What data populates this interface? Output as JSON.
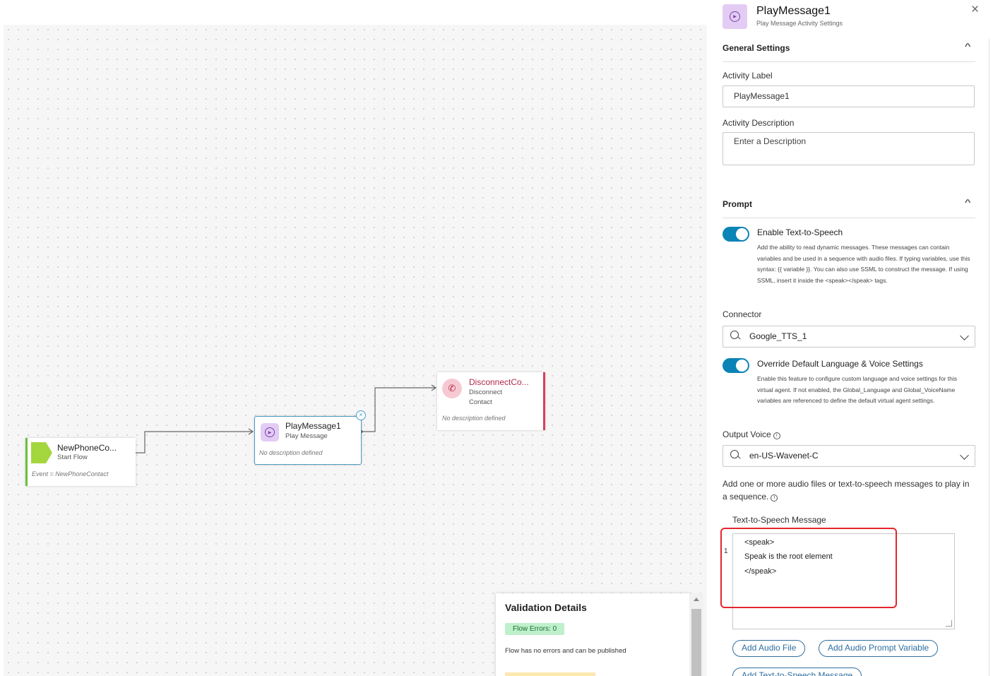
{
  "canvas": {
    "nodes": {
      "start": {
        "title": "NewPhoneCo...",
        "subtitle": "Start Flow",
        "event": "Event = NewPhoneContact"
      },
      "play": {
        "title": "PlayMessage1",
        "subtitle": "Play Message",
        "description": "No description defined",
        "close": "×"
      },
      "disconnect": {
        "title": "DisconnectCo...",
        "subtitle_line1": "Disconnect",
        "subtitle_line2": "Contact",
        "description": "No description defined"
      }
    },
    "validation": {
      "title": "Validation Details",
      "badge": "Flow Errors: 0",
      "message": "Flow has no errors and can be published"
    }
  },
  "panel": {
    "title": "PlayMessage1",
    "subtitle": "Play Message Activity Settings",
    "close": "×",
    "general": {
      "heading": "General Settings",
      "activity_label_label": "Activity Label",
      "activity_label_value": "PlayMessage1",
      "activity_description_label": "Activity Description",
      "activity_description_placeholder": "Enter a Description"
    },
    "prompt": {
      "heading": "Prompt",
      "tts_toggle_label": "Enable Text-to-Speech",
      "tts_toggle_on": true,
      "tts_desc": "Add the ability to read dynamic messages. These messages can contain variables and be used in a sequence with audio files. If typing variables, use this syntax: {{ variable }}. You can also use SSML to construct the message. If using SSML, insert it inside the <speak></speak> tags.",
      "connector_label": "Connector",
      "connector_value": "Google_TTS_1",
      "override_toggle_label": "Override Default Language & Voice Settings",
      "override_toggle_on": true,
      "override_desc": "Enable this feature to configure custom language and voice settings for this virtual agent. If not enabled, the Global_Language and Global_VoiceName variables are referenced to define the default virtual agent settings.",
      "output_voice_label": "Output Voice",
      "output_voice_value": "en-US-Wavenet-C",
      "sequence_text": "Add one or more audio files or text-to-speech messages to play in a sequence.",
      "tts_message_label": "Text-to-Speech Message",
      "line_number": "1",
      "tts_lines": [
        "<speak>",
        "Speak is the root element",
        "</speak>"
      ],
      "buttons": {
        "add_audio_file": "Add Audio File",
        "add_audio_prompt_variable": "Add Audio Prompt Variable",
        "add_tts_message": "Add Text-to-Speech Message"
      }
    }
  },
  "colors": {
    "toggle_on": "#0a84b6",
    "highlight": "#e3262c",
    "start_accent": "#6cbf3a",
    "disconnect_accent": "#d6405a",
    "play_border": "#4a9cc4"
  },
  "icons": {
    "start": "start-flow-icon",
    "play": "play-message-icon",
    "disconnect": "disconnect-icon",
    "search": "search-icon",
    "chevron": "chevron-down-icon"
  }
}
